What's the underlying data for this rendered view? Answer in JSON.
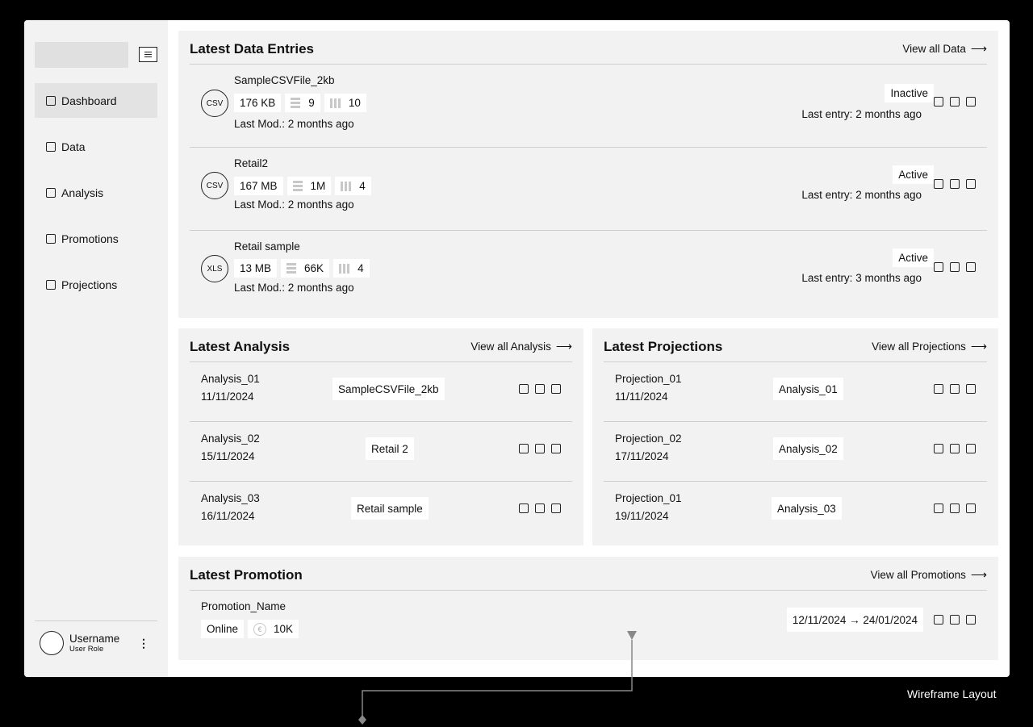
{
  "sidebar": {
    "items": [
      {
        "label": "Dashboard",
        "active": true
      },
      {
        "label": "Data"
      },
      {
        "label": "Analysis"
      },
      {
        "label": "Promotions"
      },
      {
        "label": "Projections"
      }
    ],
    "user": {
      "name": "Username",
      "role": "User Role"
    }
  },
  "data_entries": {
    "title": "Latest Data Entries",
    "view_all": "View all Data",
    "rows": [
      {
        "type": "CSV",
        "name": "SampleCSVFile_2kb",
        "size": "176 KB",
        "rows": "9",
        "cols": "10",
        "last_mod": "Last Mod.: 2 months ago",
        "status": "Inactive",
        "last_entry": "Last entry: 2 months ago"
      },
      {
        "type": "CSV",
        "name": "Retail2",
        "size": "167 MB",
        "rows": "1M",
        "cols": "4",
        "last_mod": "Last Mod.: 2 months ago",
        "status": "Active",
        "last_entry": "Last entry: 2 months ago"
      },
      {
        "type": "XLS",
        "name": "Retail sample",
        "size": "13 MB",
        "rows": "66K",
        "cols": "4",
        "last_mod": "Last Mod.: 2 months ago",
        "status": "Active",
        "last_entry": "Last entry: 3 months ago"
      }
    ]
  },
  "analysis": {
    "title": "Latest Analysis",
    "view_all": "View all Analysis",
    "rows": [
      {
        "name": "Analysis_01",
        "date": "11/11/2024",
        "source": "SampleCSVFile_2kb"
      },
      {
        "name": "Analysis_02",
        "date": "15/11/2024",
        "source": "Retail 2"
      },
      {
        "name": "Analysis_03",
        "date": "16/11/2024",
        "source": "Retail sample"
      }
    ]
  },
  "projections": {
    "title": "Latest Projections",
    "view_all": "View all Projections",
    "rows": [
      {
        "name": "Projection_01",
        "date": "11/11/2024",
        "source": "Analysis_01"
      },
      {
        "name": "Projection_02",
        "date": "17/11/2024",
        "source": "Analysis_02"
      },
      {
        "name": "Projection_01",
        "date": "19/11/2024",
        "source": "Analysis_03"
      }
    ]
  },
  "promotion": {
    "title": "Latest Promotion",
    "view_all": "View all Promotions",
    "name": "Promotion_Name",
    "channel": "Online",
    "currency_symbol": "€",
    "budget": "10K",
    "date_range": "12/11/2024 → 24/01/2024"
  },
  "arrow": "⟶",
  "wireframe_label": "Wireframe Layout"
}
